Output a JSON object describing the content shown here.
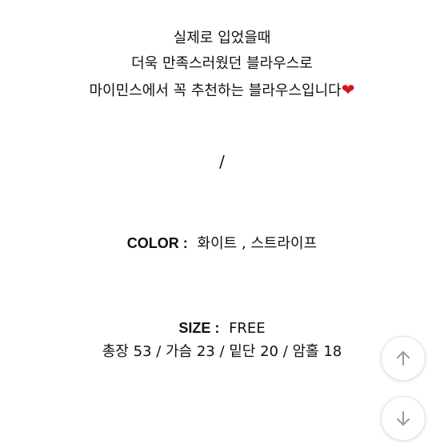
{
  "description": {
    "line1": "실제로 입었을때",
    "line2": "더욱 만족스러웠던 블라우스로",
    "line3": "마이민스에서 꼭 추천하는 블라우스입니다",
    "heart_symbol": "❤"
  },
  "separator": "/",
  "color": {
    "label": "COLOR :",
    "value": "화이트 , 스트라이프"
  },
  "size": {
    "label": "SIZE :",
    "value": "FREE",
    "measurements": "총장 53 /  가슴 23 / 밑단 20 /  암홀 18"
  },
  "controls": {
    "scroll_up_icon": "arrow-up-icon",
    "scroll_down_icon": "arrow-down-icon"
  },
  "colors": {
    "text": "#111111",
    "heart": "#d6141c",
    "icon": "#9a9a9a",
    "fab_border": "#e3e3e3"
  }
}
